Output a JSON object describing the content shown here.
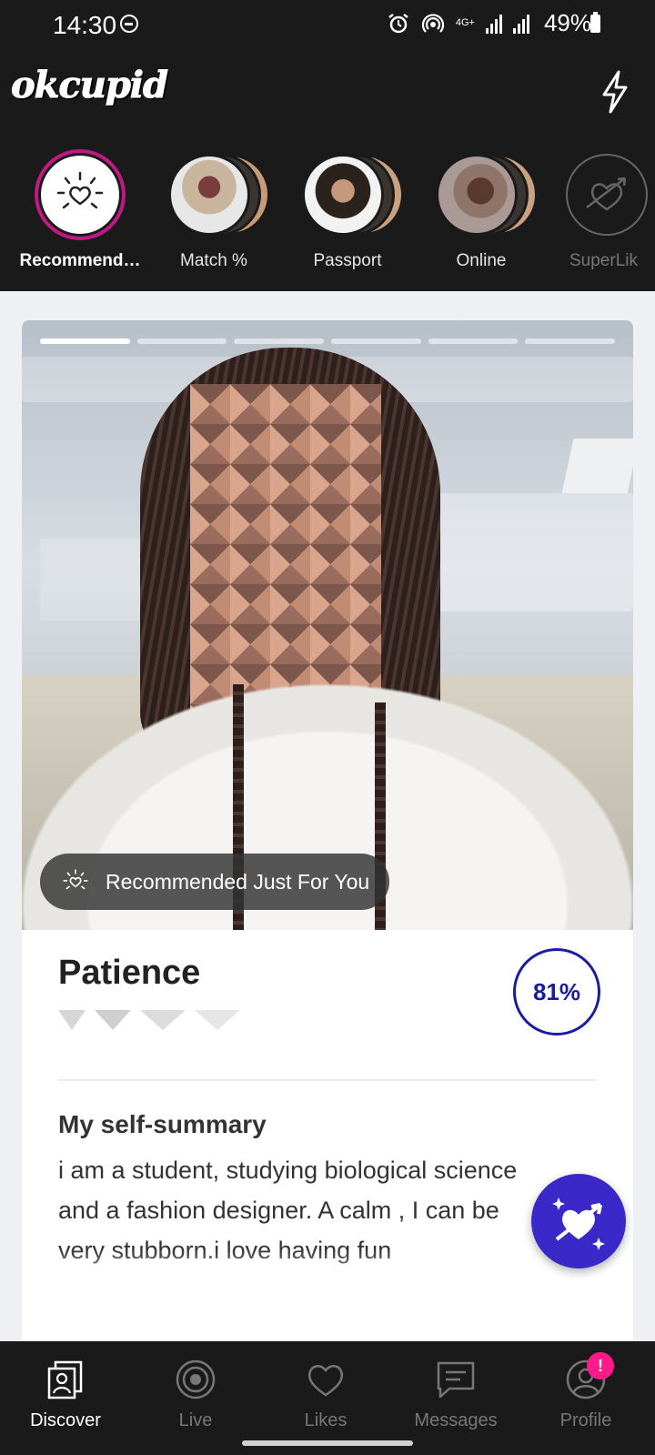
{
  "status_bar": {
    "time": "14:30",
    "network": "4G+",
    "battery": "49%"
  },
  "header": {
    "logo": "okcupid"
  },
  "stories": [
    {
      "label": "Recommend…"
    },
    {
      "label": "Match %"
    },
    {
      "label": "Passport"
    },
    {
      "label": "Online"
    },
    {
      "label": "SuperLik"
    }
  ],
  "profile_card": {
    "photo_count": 6,
    "photo_index": 1,
    "recommended_label": "Recommended Just For You",
    "name": "Patience",
    "match": "81%",
    "section_title": "My self-summary",
    "summary": "i am a student, studying biological science and a fashion designer. A calm , I can be very stubborn.i love having fun"
  },
  "bottom_nav": [
    {
      "label": "Discover",
      "icon": "discover-icon",
      "active": true
    },
    {
      "label": "Live",
      "icon": "live-icon"
    },
    {
      "label": "Likes",
      "icon": "heart-icon"
    },
    {
      "label": "Messages",
      "icon": "messages-icon"
    },
    {
      "label": "Profile",
      "icon": "profile-icon",
      "badge": "!"
    }
  ],
  "colors": {
    "accent": "#c01884",
    "match": "#1b1da1",
    "superlike": "#3a28c9",
    "badge": "#ff1a8c"
  }
}
